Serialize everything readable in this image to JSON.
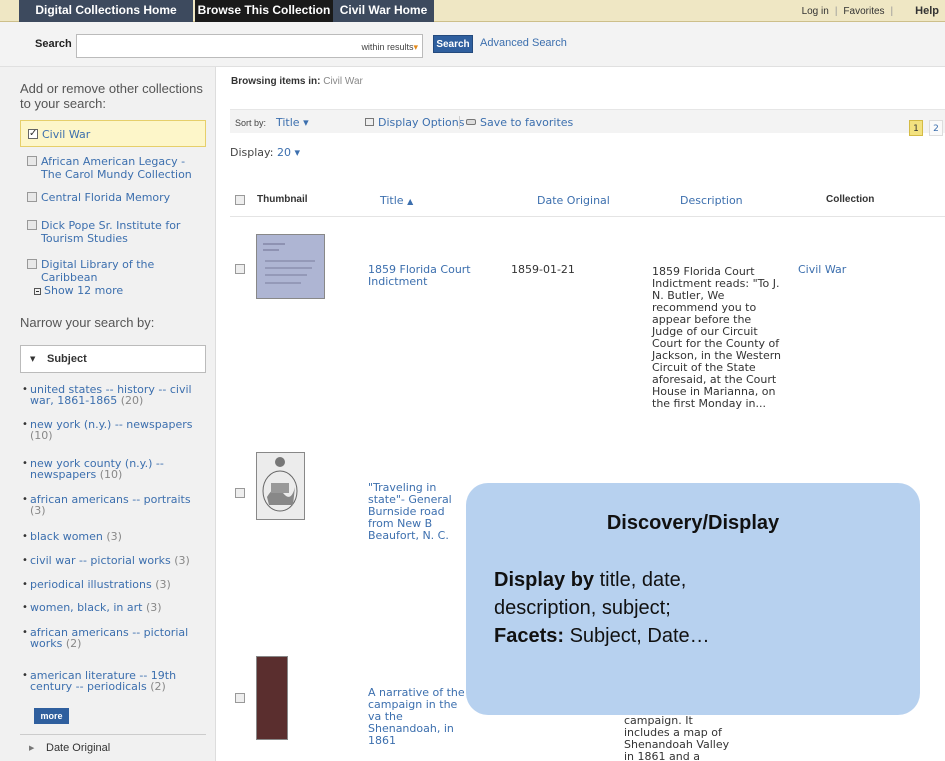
{
  "topnav": {
    "tabs": [
      "Digital Collections Home",
      "Browse This Collection",
      "Civil War Home"
    ],
    "login": "Log in",
    "favorites": "Favorites",
    "help": "Help",
    "separator": "|"
  },
  "search": {
    "label": "Search",
    "value": "",
    "within_label": "within results",
    "button": "Search",
    "advanced": "Advanced Search"
  },
  "sidebar": {
    "collections_heading": "Add or remove other collections to your search:",
    "collections": [
      {
        "label": "Civil War",
        "checked": true
      },
      {
        "label": "African American Legacy - The Carol Mundy Collection",
        "checked": false
      },
      {
        "label": "Central Florida Memory",
        "checked": false
      },
      {
        "label": "Dick Pope Sr. Institute for Tourism Studies",
        "checked": false
      },
      {
        "label": "Digital Library of the Caribbean",
        "checked": false
      }
    ],
    "show_more": "Show 12 more",
    "narrow_heading": "Narrow your search by:",
    "subject_facet": "Subject",
    "subjects": [
      {
        "label": "united states -- history -- civil war, 1861-1865",
        "count": "(20)"
      },
      {
        "label": "new york (n.y.) -- newspapers",
        "count": "(10)"
      },
      {
        "label": "new york county (n.y.) -- newspapers",
        "count": "(10)"
      },
      {
        "label": "african americans -- portraits",
        "count": "(3)"
      },
      {
        "label": "black women",
        "count": "(3)"
      },
      {
        "label": "civil war -- pictorial works",
        "count": "(3)"
      },
      {
        "label": "periodical illustrations",
        "count": "(3)"
      },
      {
        "label": "women, black, in art",
        "count": "(3)"
      },
      {
        "label": "african americans -- pictorial works",
        "count": "(2)"
      },
      {
        "label": "american literature -- 19th century -- periodicals",
        "count": "(2)"
      }
    ],
    "more_button": "more",
    "date_facet": "Date Original"
  },
  "main": {
    "browsing_label": "Browsing items in:",
    "browsing_value": "Civil War",
    "sort_label": "Sort by:",
    "sort_value": "Title",
    "display_options": "Display Options",
    "save_favorites": "Save to favorites",
    "pages": [
      "1",
      "2"
    ],
    "display_label": "Display:",
    "display_value": "20",
    "columns": {
      "thumbnail": "Thumbnail",
      "title": "Title",
      "date": "Date Original",
      "description": "Description",
      "collection": "Collection"
    },
    "rows": [
      {
        "title": "1859 Florida Court Indictment",
        "date": "1859-01-21",
        "description": "1859 Florida Court Indictment reads: \"To J. N. Butler, We recommend you to appear before the Judge of our Circuit Court for the County of Jackson, in the Western Circuit of the State aforesaid, at the Court House in Marianna, on the first Monday in...",
        "collection": "Civil War"
      },
      {
        "title": "\"Traveling in state\"- General Burnside road from New B Beaufort, N. C.",
        "date": "",
        "description": "",
        "collection": ""
      },
      {
        "title": "A narrative of the campaign in the va the Shenandoah, in 1861",
        "date": "",
        "description": "campaign. It includes a map of Shenandoah Valley in 1861 and a",
        "collection": ""
      }
    ]
  },
  "callout": {
    "title": "Discovery/Display",
    "line1_bold": "Display by",
    "line1_rest": " title, date,",
    "line2": "description, subject;",
    "line3_bold": "Facets:",
    "line3_rest": " Subject, Date…"
  }
}
